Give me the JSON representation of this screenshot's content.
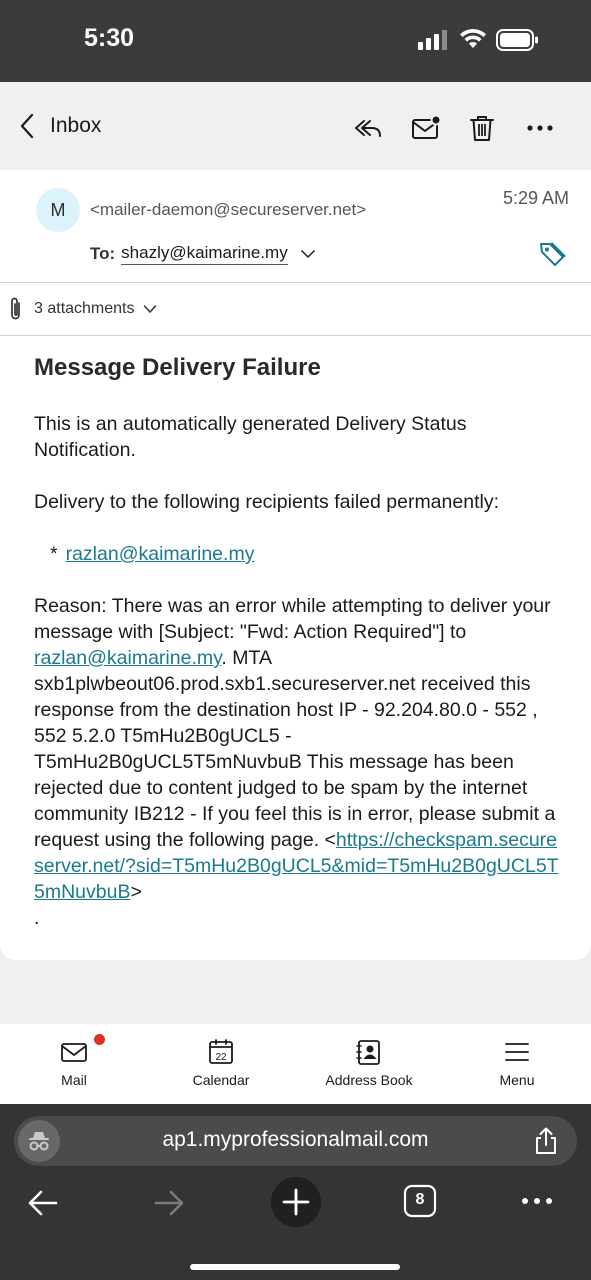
{
  "status_bar": {
    "time": "5:30"
  },
  "header": {
    "back_label": "Inbox",
    "actions": [
      "reply-all-icon",
      "mark-unread-icon",
      "trash-icon",
      "more-icon"
    ]
  },
  "email": {
    "avatar_initial": "M",
    "from": "<mailer-daemon@secureserver.net>",
    "time": "5:29 AM",
    "to_label": "To:",
    "to_address": "shazly@kaimarine.my",
    "attachments_label": "3 attachments",
    "subject": "Message Delivery Failure",
    "body": {
      "p1": "This is an automatically generated Delivery Status Notification.",
      "p2": "Delivery to the following recipients failed permanently:",
      "bullet_star": "*",
      "recipient_link": "razlan@kaimarine.my",
      "reason_1": "Reason: There was an error while attempting to deliver your message with [Subject: \"Fwd: Action Required\"] to ",
      "reason_link": "razlan@kaimarine.my",
      "reason_2": ". MTA sxb1plwbeout06.prod.sxb1.secureserver.net received this response from the destination host IP - 92.204.80.0 -  552 , 552 5.2.0 T5mHu2B0gUCL5 - T5mHu2B0gUCL5T5mNuvbuB This message has been rejected due to content judged to be spam by the internet community IB212 - If you feel this is in error, please submit a request using the following page. <",
      "spam_link": "https://checkspam.secureserver.net/?sid=T5mHu2B0gUCL5&mid=T5mHu2B0gUCL5T5mNuvbuB",
      "reason_end": ">",
      "trailing_dot": "."
    }
  },
  "bottom_nav": [
    {
      "label": "Mail",
      "icon": "mail-icon"
    },
    {
      "label": "Calendar",
      "icon": "calendar-icon",
      "day": "22"
    },
    {
      "label": "Address Book",
      "icon": "address-book-icon"
    },
    {
      "label": "Menu",
      "icon": "menu-icon"
    }
  ],
  "browser": {
    "url": "ap1.myprofessionalmail.com",
    "tab_count": "8"
  },
  "colors": {
    "accent_link": "#1b7a8e",
    "notification_dot": "#e0301e",
    "status_bar": "#3a3b3d"
  }
}
